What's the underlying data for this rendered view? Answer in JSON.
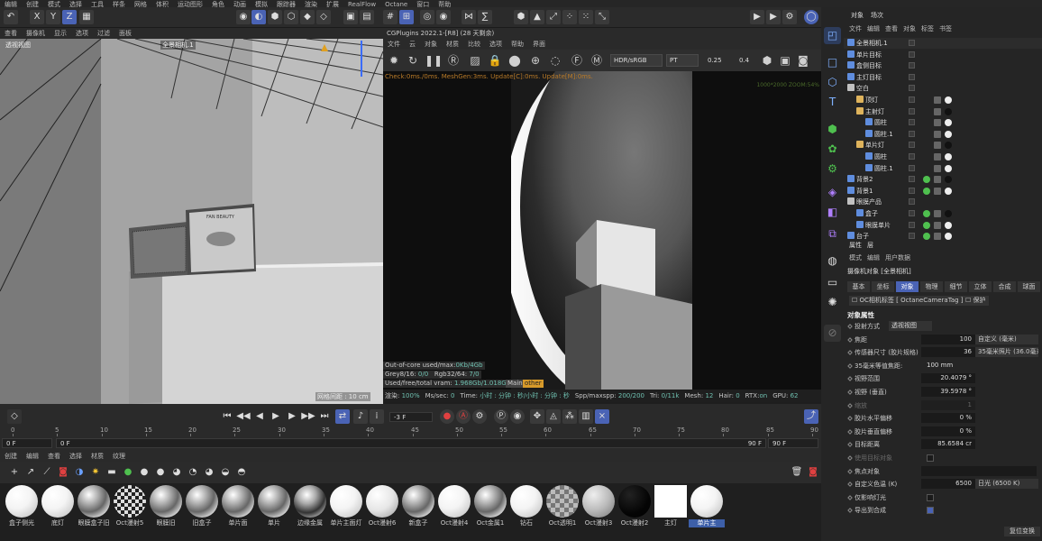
{
  "menubar": [
    "编辑",
    "创建",
    "模式",
    "选择",
    "工具",
    "样条",
    "网格",
    "体积",
    "运动图形",
    "角色",
    "动画",
    "模拟",
    "跟踪器",
    "渲染",
    "扩展",
    "RealFlow",
    "Octane",
    "窗口",
    "帮助"
  ],
  "viewport": {
    "menu": [
      "查看",
      "摄像机",
      "显示",
      "选项",
      "过滤",
      "面板"
    ],
    "label": "透视视图",
    "camera_tag": "全景相机.1",
    "grid_spacing": "网格间距 : 10 cm",
    "product_text": "FAN BEAUTY"
  },
  "render_view": {
    "title": "CGPlugins   2022.1-[R8] (28 天剩余)",
    "menu": [
      "文件",
      "云",
      "对象",
      "材质",
      "比较",
      "选项",
      "帮助",
      "界面"
    ],
    "color_mode": "HDR/sRGB",
    "kernel": "PT",
    "value_a": "0.25",
    "value_b": "0.4",
    "status": "Check:0ms./0ms. MeshGen:3ms. Update[C]:0ms. Update[M]:0ms.",
    "zoom": "1000*2000 ZOOM:54%",
    "ooc_label": "Out-of-core used/max:",
    "ooc_val": "0Kb/4Gb",
    "grey_label": "Grey8/16: ",
    "grey_val": "0/0",
    "rgb_label": "Rgb32/64: ",
    "rgb_val": "7/0",
    "vram_label": "Used/free/total vram: ",
    "vram_val": "1.968Gb/1.018Gb/8Gb",
    "tab_main": "Main",
    "tab_other": "other",
    "footer": [
      {
        "label": "渲染: ",
        "value": "100%"
      },
      {
        "label": "Ms/sec: ",
        "value": "0"
      },
      {
        "label": "Time: ",
        "value": "小时 : 分钟 : 秒/小时 : 分钟 : 秒"
      },
      {
        "label": "Spp/maxspp: ",
        "value": "200/200"
      },
      {
        "label": "Tri: ",
        "value": "0/11k"
      },
      {
        "label": "Mesh: ",
        "value": "12"
      },
      {
        "label": "Hair: ",
        "value": "0"
      },
      {
        "label": "RTX:",
        "value": "on"
      },
      {
        "label": "GPU: ",
        "value": "62"
      }
    ]
  },
  "timeline": {
    "current_frame": "-3 F",
    "ticks": [
      "0",
      "5",
      "10",
      "15",
      "20",
      "25",
      "30",
      "35",
      "40",
      "45",
      "50",
      "55",
      "60",
      "65",
      "70",
      "75",
      "80",
      "85",
      "90"
    ],
    "start": "0 F",
    "start2": "0 F",
    "end": "90 F",
    "end2": "90 F"
  },
  "materials": {
    "menu": [
      "创建",
      "编辑",
      "查看",
      "选择",
      "材质",
      "纹理"
    ],
    "items": [
      {
        "name": "盒子侧光",
        "style": "white"
      },
      {
        "name": "底灯",
        "style": "white"
      },
      {
        "name": "眼膜盒子旧",
        "style": "glass"
      },
      {
        "name": "Oct漫射5",
        "style": "checker"
      },
      {
        "name": "眼膜旧",
        "style": "glass"
      },
      {
        "name": "旧盒子",
        "style": "glass"
      },
      {
        "name": "单片面",
        "style": "glass"
      },
      {
        "name": "单片",
        "style": "glass"
      },
      {
        "name": "边缘金属",
        "style": "chrome"
      },
      {
        "name": "单片主面灯",
        "style": "white"
      },
      {
        "name": "Oct漫射6",
        "style": "soft"
      },
      {
        "name": "新盒子",
        "style": "glass"
      },
      {
        "name": "Oct漫射4",
        "style": "white"
      },
      {
        "name": "Oct金属1",
        "style": "glass"
      },
      {
        "name": "钻石",
        "style": "white"
      },
      {
        "name": "Oct透明1",
        "style": "checker2"
      },
      {
        "name": "Oct漫射3",
        "style": "grey"
      },
      {
        "name": "Oct漫射2",
        "style": "black"
      },
      {
        "name": "主灯",
        "style": "square"
      },
      {
        "name": "单片主",
        "style": "white"
      }
    ]
  },
  "objects": {
    "tabs": [
      "对象",
      "场次"
    ],
    "menu": [
      "文件",
      "编辑",
      "查看",
      "对象",
      "标签",
      "书签"
    ],
    "rows": [
      {
        "name": "全景相机.1",
        "indent": 0,
        "icon": "camera"
      },
      {
        "name": "单片目标",
        "indent": 0,
        "icon": "target"
      },
      {
        "name": "盒侧目标",
        "indent": 0,
        "icon": "target"
      },
      {
        "name": "主灯目标",
        "indent": 0,
        "icon": "target"
      },
      {
        "name": "空白",
        "indent": 0,
        "icon": "null"
      },
      {
        "name": "顶灯",
        "indent": 1,
        "icon": "light"
      },
      {
        "name": "主射灯",
        "indent": 1,
        "icon": "light"
      },
      {
        "name": "圆柱",
        "indent": 2,
        "icon": "cylinder"
      },
      {
        "name": "圆柱.1",
        "indent": 2,
        "icon": "cylinder"
      },
      {
        "name": "单片灯",
        "indent": 1,
        "icon": "light"
      },
      {
        "name": "圆柱",
        "indent": 2,
        "icon": "cylinder"
      },
      {
        "name": "圆柱.1",
        "indent": 2,
        "icon": "cylinder"
      },
      {
        "name": "背景2",
        "indent": 0,
        "icon": "bg"
      },
      {
        "name": "背景1",
        "indent": 0,
        "icon": "bg"
      },
      {
        "name": "眼膜产品",
        "indent": 0,
        "icon": "null"
      },
      {
        "name": "盒子",
        "indent": 1,
        "icon": "mesh"
      },
      {
        "name": "眼膜单片",
        "indent": 1,
        "icon": "mesh"
      },
      {
        "name": "台子",
        "indent": 0,
        "icon": "mesh"
      }
    ]
  },
  "attributes": {
    "tabs": [
      "属性",
      "层"
    ],
    "menu": [
      "模式",
      "编辑",
      "用户数据"
    ],
    "header": "摄像机对象 [全景相机]",
    "buttons": [
      "基本",
      "坐标",
      "对象",
      "物理",
      "细节",
      "立体",
      "合成",
      "球面"
    ],
    "tag1": "OC相机标签 [ OctaneCameraTag ]",
    "tag2": "保护",
    "section": "对象属性",
    "rows": [
      {
        "label": "投射方式",
        "value": "透视视图",
        "extra": ""
      },
      {
        "label": "焦距",
        "value": "100",
        "extra": "自定义 (毫米)"
      },
      {
        "label": "传感器尺寸 (胶片规格)",
        "value": "36",
        "extra": "35毫米照片 (36.0毫米)"
      },
      {
        "label": "35毫米等值焦距:",
        "value": "100 mm",
        "extra": ""
      },
      {
        "label": "视野范围",
        "value": "20.4079 °",
        "extra": ""
      },
      {
        "label": "视野 (垂直)",
        "value": "39.5978 °",
        "extra": ""
      },
      {
        "label": "缩放",
        "value": "1",
        "extra": ""
      },
      {
        "label": "胶片水平偏移",
        "value": "0 %",
        "extra": ""
      },
      {
        "label": "胶片垂直偏移",
        "value": "0 %",
        "extra": ""
      },
      {
        "label": "目标距离",
        "value": "85.6584 cr",
        "extra": ""
      },
      {
        "label": "使用目标对象",
        "value": "",
        "extra": ""
      },
      {
        "label": "焦点对象",
        "value": "",
        "extra": ""
      },
      {
        "label": "自定义色温 (K)",
        "value": "6500",
        "extra": "日光 (6500 K)"
      },
      {
        "label": "仅影响灯光",
        "value": "",
        "extra": ""
      },
      {
        "label": "导出到合成",
        "value": "",
        "extra": ""
      }
    ],
    "reset": "复位变换"
  },
  "colors": {
    "accent": "#4a63b5",
    "panel": "#252525",
    "sel_blue": "#3d5fa8"
  }
}
